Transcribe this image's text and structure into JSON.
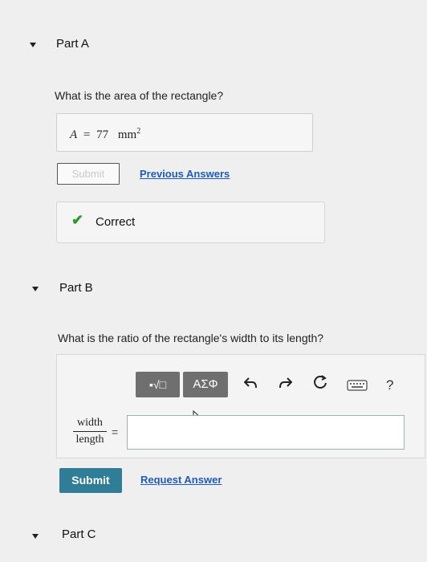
{
  "part_a": {
    "title": "Part A",
    "question": "What is the area of the rectangle?",
    "answer": {
      "variable": "A",
      "equals": "=",
      "value": "77",
      "unit": "mm",
      "unit_power": "2"
    },
    "submit_label": "Submit",
    "previous_answers_label": "Previous Answers",
    "feedback": "Correct"
  },
  "part_b": {
    "title": "Part B",
    "question": "What is the ratio of the rectangle's width to its length?",
    "toolbar": {
      "template_label": "▪√□",
      "symbols_label": "ΑΣΦ",
      "undo_icon": "undo-icon",
      "redo_icon": "redo-icon",
      "reset_icon": "reset-icon",
      "keyboard_icon": "keyboard-icon",
      "help_label": "?"
    },
    "fraction": {
      "numerator": "width",
      "denominator": "length"
    },
    "equals": "=",
    "input_value": "",
    "submit_label": "Submit",
    "request_answer_label": "Request Answer"
  },
  "part_c": {
    "title": "Part C"
  }
}
